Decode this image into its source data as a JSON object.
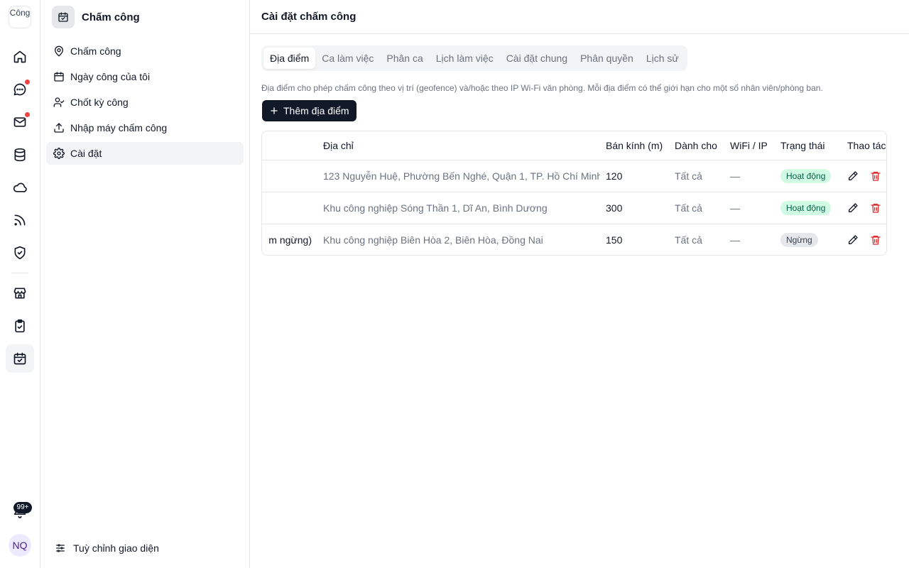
{
  "rail": {
    "logo_alt": "Công",
    "notification_count": "99+",
    "avatar_initials": "NQ"
  },
  "sidebar": {
    "title": "Chấm công",
    "items": [
      {
        "label": "Chấm công",
        "icon": "map-pin-icon"
      },
      {
        "label": "Ngày công của tôi",
        "icon": "calendar-icon"
      },
      {
        "label": "Chốt kỳ công",
        "icon": "user-check-icon"
      },
      {
        "label": "Nhập máy chấm công",
        "icon": "upload-icon"
      },
      {
        "label": "Cài đặt",
        "icon": "gear-icon"
      }
    ],
    "footer": "Tuỳ chỉnh giao diện"
  },
  "main": {
    "title": "Cài đặt chấm công",
    "tabs": [
      "Địa điểm",
      "Ca làm việc",
      "Phân ca",
      "Lịch làm việc",
      "Cài đặt chung",
      "Phân quyền",
      "Lịch sử"
    ],
    "description": "Địa điểm cho phép chấm công theo vị trí (geofence) và/hoặc theo IP Wi-Fi văn phòng. Mỗi địa điểm có thể giới hạn cho một số nhân viên/phòng ban.",
    "add_label": "Thêm địa điểm",
    "columns": [
      "",
      "Địa chỉ",
      "Bán kính (m)",
      "Dành cho",
      "WiFi / IP",
      "Trạng thái",
      "Thao tác"
    ],
    "rows": [
      {
        "name": "",
        "address": "123 Nguyễn Huệ, Phường Bến Nghé, Quận 1, TP. Hồ Chí Minh",
        "radius": "120",
        "for": "Tất cả",
        "wifi": "—",
        "status": "Hoạt động"
      },
      {
        "name": "",
        "address": "Khu công nghiệp Sóng Thần 1, Dĩ An, Bình Dương",
        "radius": "300",
        "for": "Tất cả",
        "wifi": "—",
        "status": "Hoạt động"
      },
      {
        "name": "m ngừng)",
        "address": "Khu công nghiệp Biên Hòa 2, Biên Hòa, Đồng Nai",
        "radius": "150",
        "for": "Tất cả",
        "wifi": "—",
        "status": "Ngừng"
      }
    ]
  },
  "colors": {
    "primary": "#111827",
    "active_badge_bg": "#d1fae5",
    "active_badge_text": "#065f46",
    "danger": "#dc2626",
    "notification_dot": "#ef4444"
  }
}
